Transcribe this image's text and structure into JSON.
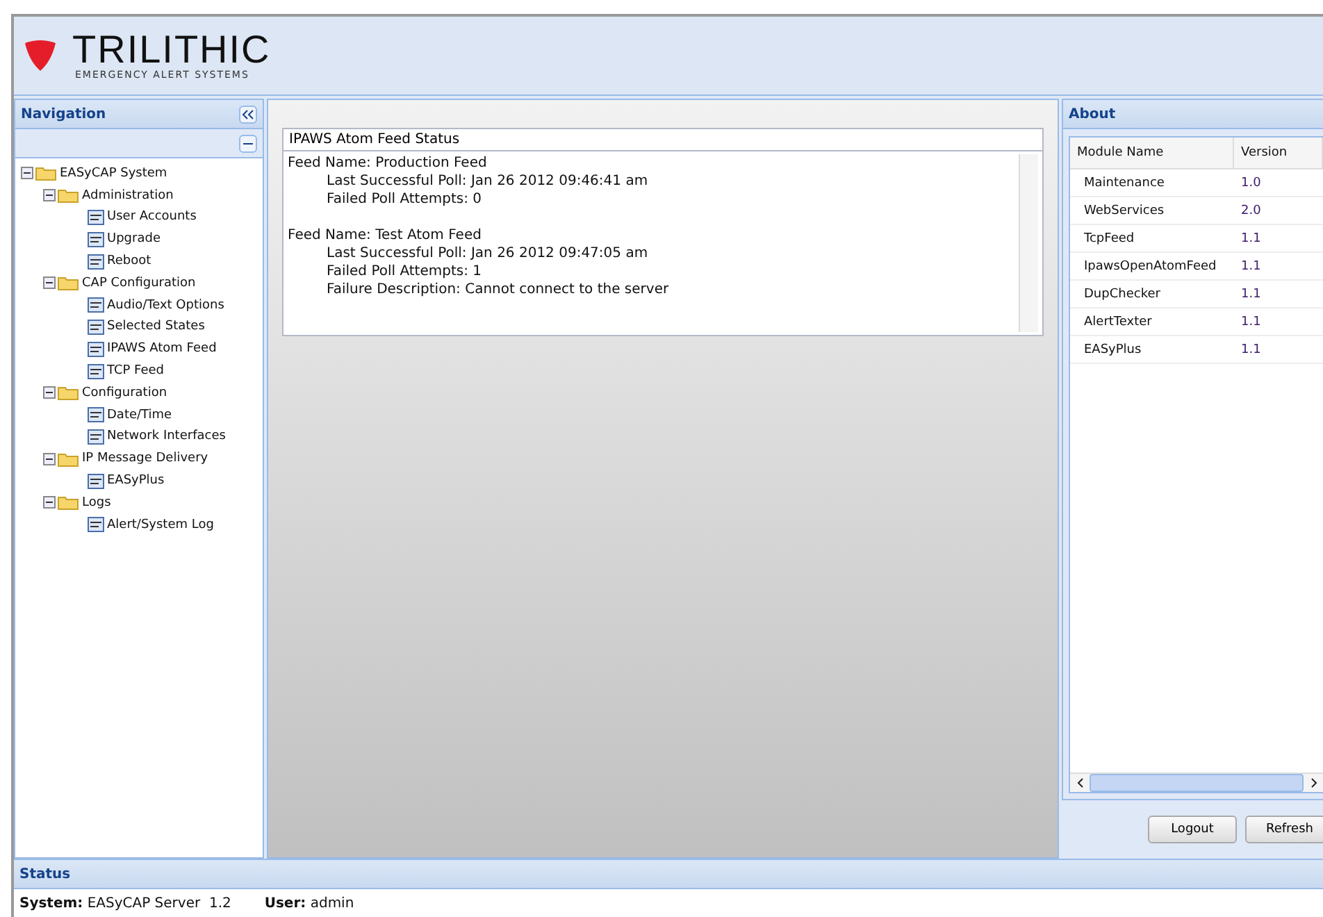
{
  "header": {
    "brand": "TRILITHIC",
    "tagline": "EMERGENCY ALERT SYSTEMS"
  },
  "navigation": {
    "title": "Navigation",
    "tree": [
      {
        "label": "EASyCAP System",
        "kind": "folder",
        "expanded": true,
        "children": [
          {
            "label": "Administration",
            "kind": "folder",
            "expanded": true,
            "children": [
              {
                "label": "User Accounts",
                "kind": "page"
              },
              {
                "label": "Upgrade",
                "kind": "page"
              },
              {
                "label": "Reboot",
                "kind": "page"
              }
            ]
          },
          {
            "label": "CAP Configuration",
            "kind": "folder",
            "expanded": true,
            "children": [
              {
                "label": "Audio/Text Options",
                "kind": "page"
              },
              {
                "label": "Selected States",
                "kind": "page"
              },
              {
                "label": "IPAWS Atom Feed",
                "kind": "page"
              },
              {
                "label": "TCP Feed",
                "kind": "page"
              }
            ]
          },
          {
            "label": "Configuration",
            "kind": "folder",
            "expanded": true,
            "children": [
              {
                "label": "Date/Time",
                "kind": "page"
              },
              {
                "label": "Network Interfaces",
                "kind": "page"
              }
            ]
          },
          {
            "label": "IP Message Delivery",
            "kind": "folder",
            "expanded": true,
            "children": [
              {
                "label": "EASyPlus",
                "kind": "page"
              }
            ]
          },
          {
            "label": "Logs",
            "kind": "folder",
            "expanded": true,
            "children": [
              {
                "label": "Alert/System Log",
                "kind": "page"
              }
            ]
          }
        ]
      }
    ]
  },
  "feed_status": {
    "title": "IPAWS Atom Feed Status",
    "feeds": [
      {
        "name": "Feed Name: Production Feed",
        "details": [
          "Last Successful Poll: Jan 26 2012 09:46:41 am",
          "Failed Poll Attempts: 0"
        ]
      },
      {
        "name": "Feed Name: Test Atom Feed",
        "details": [
          "Last Successful Poll: Jan 26 2012 09:47:05 am",
          "Failed Poll Attempts: 1",
          "Failure Description: Cannot connect to the server"
        ]
      }
    ]
  },
  "about": {
    "title": "About",
    "columns": [
      "Module Name",
      "Version"
    ],
    "rows": [
      [
        "Maintenance",
        "1.0"
      ],
      [
        "WebServices",
        "2.0"
      ],
      [
        "TcpFeed",
        "1.1"
      ],
      [
        "IpawsOpenAtomFeed",
        "1.1"
      ],
      [
        "DupChecker",
        "1.1"
      ],
      [
        "AlertTexter",
        "1.1"
      ],
      [
        "EASyPlus",
        "1.1"
      ]
    ]
  },
  "buttons": [
    "Logout",
    "Refresh"
  ],
  "status": {
    "title": "Status",
    "fields": [
      {
        "label": "System:",
        "value": "EASyCAP Server  1.2"
      },
      {
        "label": "User:",
        "value": "admin"
      }
    ]
  }
}
